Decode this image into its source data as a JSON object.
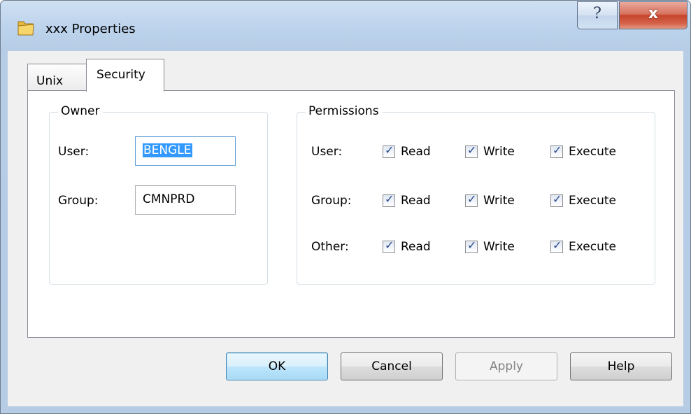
{
  "window": {
    "title": "xxx Properties",
    "icon": "folder-icon",
    "help_glyph": "?",
    "close_glyph": "x"
  },
  "tabs": [
    {
      "label": "Unix",
      "selected": false
    },
    {
      "label": "Security",
      "selected": true
    }
  ],
  "owner": {
    "title": "Owner",
    "user_label": "User:",
    "user_value": "BENGLE",
    "group_label": "Group:",
    "group_value": "CMNPRD"
  },
  "permissions": {
    "title": "Permissions",
    "rows": [
      {
        "label": "User:",
        "read": "Read",
        "write": "Write",
        "execute": "Execute",
        "read_checked": true,
        "write_checked": true,
        "execute_checked": true
      },
      {
        "label": "Group:",
        "read": "Read",
        "write": "Write",
        "execute": "Execute",
        "read_checked": true,
        "write_checked": true,
        "execute_checked": true
      },
      {
        "label": "Other:",
        "read": "Read",
        "write": "Write",
        "execute": "Execute",
        "read_checked": true,
        "write_checked": true,
        "execute_checked": true
      }
    ]
  },
  "buttons": {
    "ok": "OK",
    "cancel": "Cancel",
    "apply": "Apply",
    "help": "Help"
  },
  "colors": {
    "accent": "#3399ff",
    "title_bar": "#bcd3ec",
    "close_button": "#c7442c"
  }
}
